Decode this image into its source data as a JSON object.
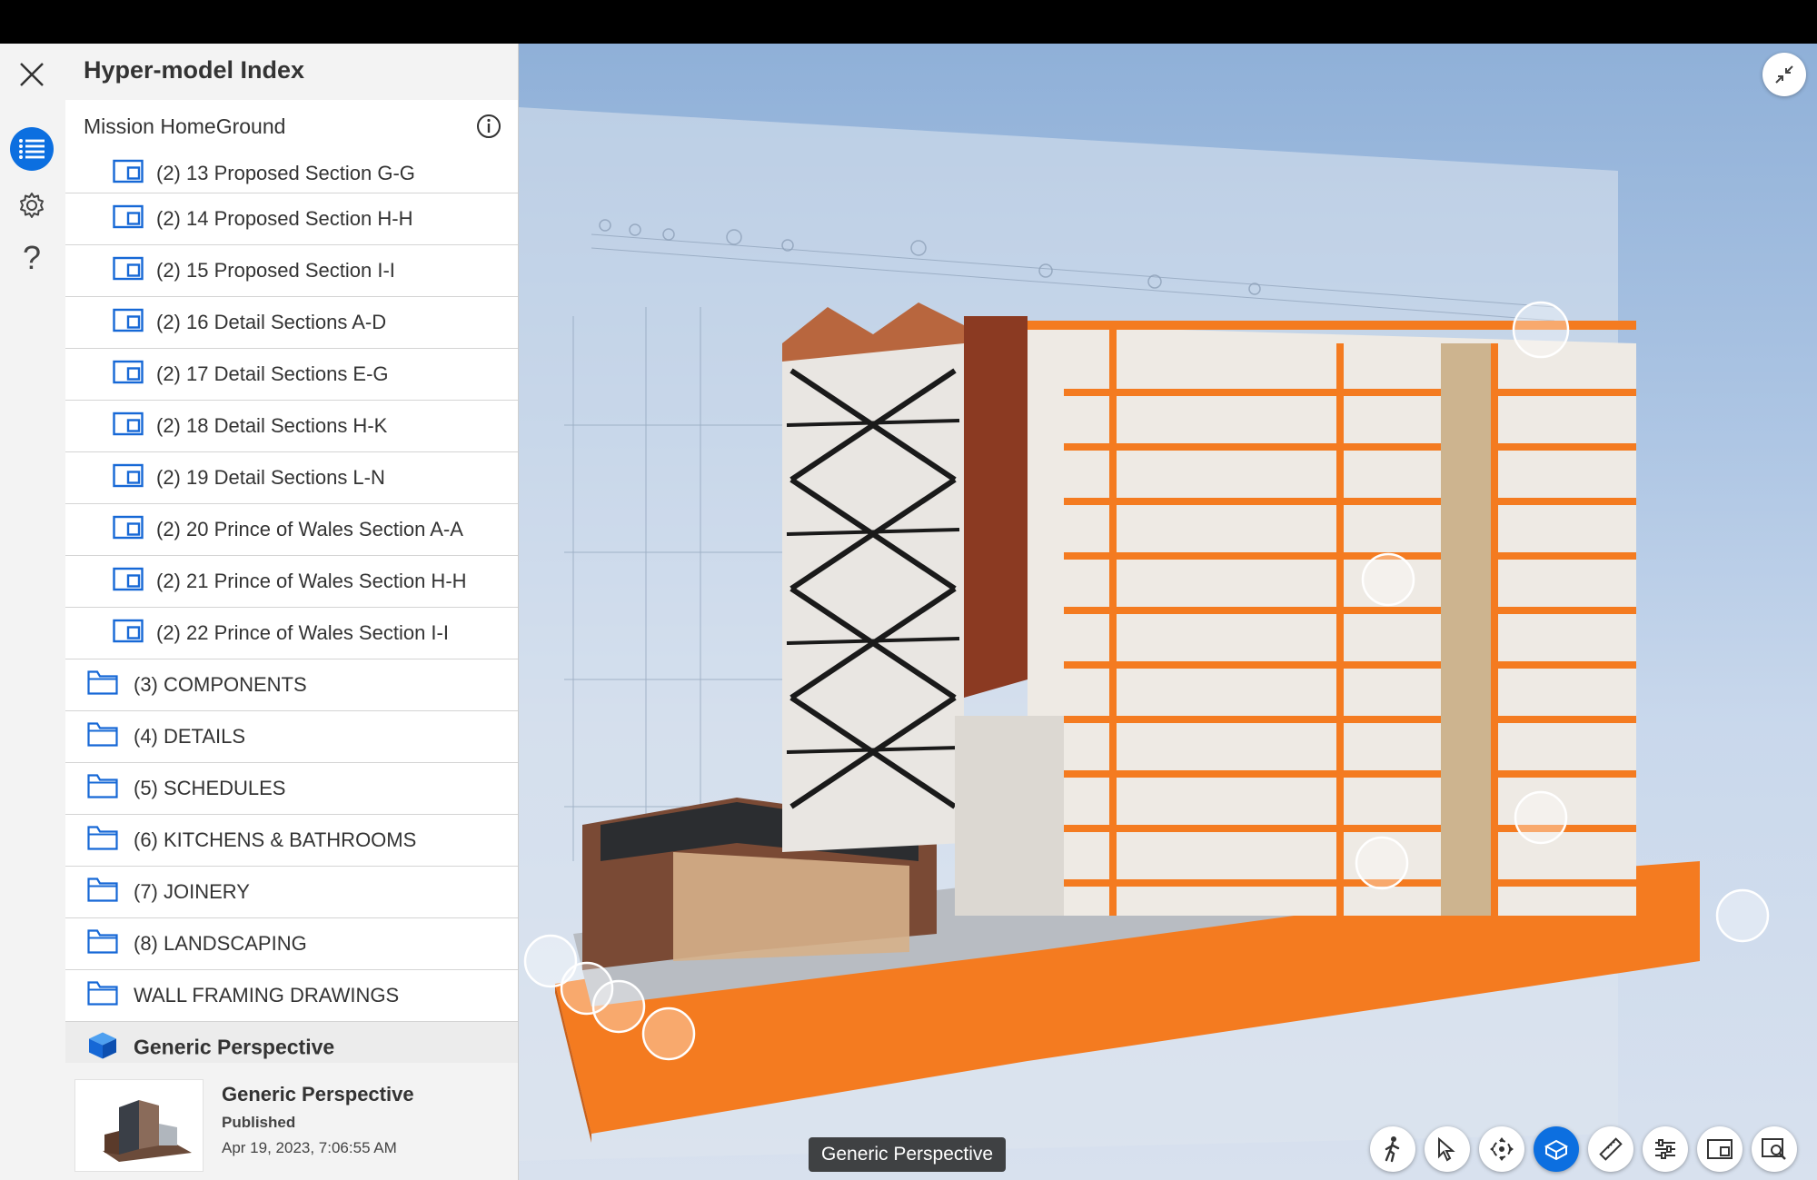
{
  "panel": {
    "title": "Hyper-model Index",
    "project_name": "Mission HomeGround",
    "items": [
      {
        "type": "sheet",
        "label": "(2) 13 Proposed Section G-G"
      },
      {
        "type": "sheet",
        "label": "(2) 14 Proposed Section H-H"
      },
      {
        "type": "sheet",
        "label": "(2) 15 Proposed Section I-I"
      },
      {
        "type": "sheet",
        "label": "(2) 16 Detail Sections A-D"
      },
      {
        "type": "sheet",
        "label": "(2) 17 Detail Sections E-G"
      },
      {
        "type": "sheet",
        "label": "(2) 18 Detail Sections H-K"
      },
      {
        "type": "sheet",
        "label": "(2) 19 Detail Sections L-N"
      },
      {
        "type": "sheet",
        "label": "(2) 20 Prince of Wales Section A-A"
      },
      {
        "type": "sheet",
        "label": "(2) 21 Prince of Wales Section H-H"
      },
      {
        "type": "sheet",
        "label": "(2) 22 Prince of Wales Section I-I"
      },
      {
        "type": "folder",
        "label": "(3) COMPONENTS"
      },
      {
        "type": "folder",
        "label": "(4) DETAILS"
      },
      {
        "type": "folder",
        "label": "(5) SCHEDULES"
      },
      {
        "type": "folder",
        "label": "(6) KITCHENS & BATHROOMS"
      },
      {
        "type": "folder",
        "label": "(7) JOINERY"
      },
      {
        "type": "folder",
        "label": "(8) LANDSCAPING"
      },
      {
        "type": "folder",
        "label": "WALL FRAMING DRAWINGS"
      },
      {
        "type": "view",
        "label": "Generic Perspective"
      }
    ],
    "preview": {
      "title": "Generic Perspective",
      "status": "Published",
      "date": "Apr 19, 2023, 7:06:55 AM"
    }
  },
  "rail": {
    "icons": [
      "close-icon",
      "list-icon",
      "gear-icon",
      "help-icon"
    ]
  },
  "viewport": {
    "tooltip": "Generic Perspective",
    "toolbar": [
      "walk-icon",
      "select-icon",
      "orbit-icon",
      "section-box-icon",
      "measure-icon",
      "settings-sliders-icon",
      "sheet-icon",
      "zoom-extents-icon"
    ],
    "active_tool": "section-box-icon"
  },
  "colors": {
    "accent": "#0c6fe0",
    "model_cut": "#f47b20",
    "panel_bg": "#f3f3f3"
  }
}
